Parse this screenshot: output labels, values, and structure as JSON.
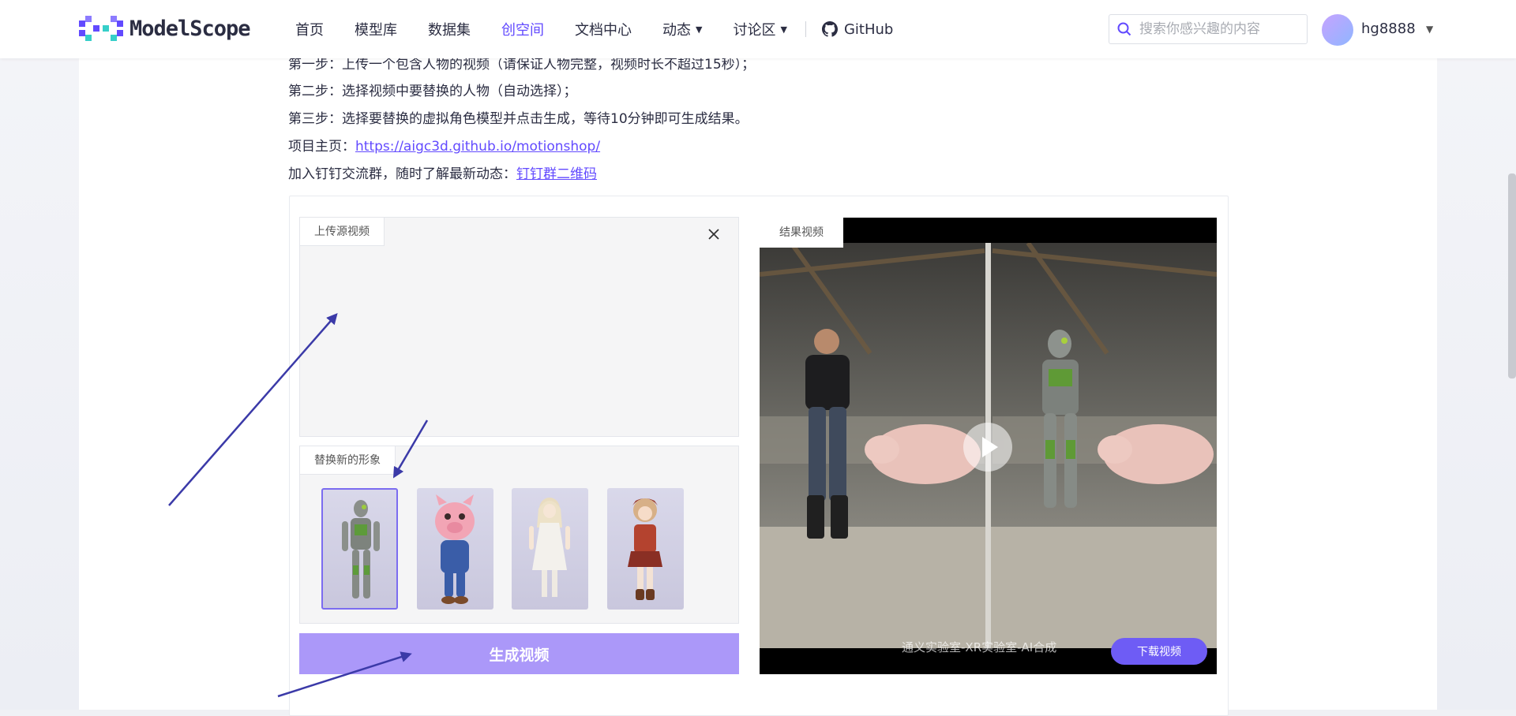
{
  "header": {
    "logo_text": "ModelScope",
    "nav": [
      {
        "label": "首页"
      },
      {
        "label": "模型库"
      },
      {
        "label": "数据集"
      },
      {
        "label": "创空间",
        "active": true
      },
      {
        "label": "文档中心"
      },
      {
        "label": "动态",
        "dropdown": true
      },
      {
        "label": "讨论区",
        "dropdown": true
      }
    ],
    "github_label": "GitHub",
    "search_placeholder": "搜索你感兴趣的内容",
    "username": "hg8888"
  },
  "content": {
    "step1": "第一步：上传一个包含人物的视频（请保证人物完整，视频时长不超过15秒）；",
    "step2": "第二步：选择视频中要替换的人物（自动选择）；",
    "step3": "第三步：选择要替换的虚拟角色模型并点击生成，等待10分钟即可生成结果。",
    "homepage_prefix": "项目主页：",
    "homepage_link": "https://aigc3d.github.io/motionshop/",
    "dingtalk_prefix": "加入钉钉交流群，随时了解最新动态：",
    "dingtalk_link": "钉钉群二维码"
  },
  "upload": {
    "label": "上传源视频"
  },
  "characters": {
    "label": "替换新的形象",
    "items": [
      {
        "name": "robot",
        "selected": true
      },
      {
        "name": "pig"
      },
      {
        "name": "white-dress-girl"
      },
      {
        "name": "red-outfit-girl"
      }
    ]
  },
  "generate_button": "生成视频",
  "result": {
    "label": "结果视频",
    "watermark": "通义实验室-XR实验室-AI合成",
    "download_button": "下载视频"
  },
  "colors": {
    "accent": "#624aff",
    "generate_button": "#ab98f9",
    "download_button": "#6e5cf5",
    "annotation_arrow": "#3b3aa8"
  }
}
